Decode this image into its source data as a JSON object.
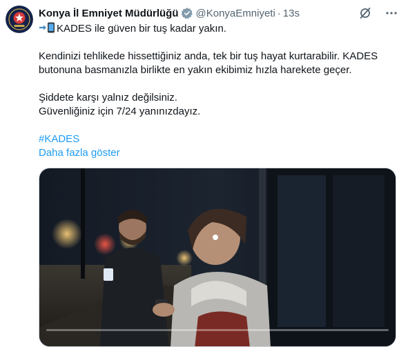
{
  "author": {
    "name": "Konya İl Emniyet Müdürlüğü",
    "handle": "@KonyaEmniyeti",
    "separator": "·",
    "time": "13s"
  },
  "icons": {
    "avatar": "police-badge-icon",
    "verified": "verified-badge-icon",
    "grok": "grok-icon",
    "more": "more-icon",
    "phone": "mobile-phone-arrow-emoji"
  },
  "tweet": {
    "line1": "KADES ile güven bir tuş kadar yakın.",
    "line2": "Kendinizi tehlikede hissettiğiniz anda, tek bir tuş hayat kurtarabilir. KADES",
    "line3": "butonuna basmanızla birlikte en yakın ekibimiz hızla harekete geçer.",
    "line4": "Şiddete karşı yalnız değilsiniz.",
    "line5": "Güvenliğiniz için 7/24 yanınızdayız.",
    "hashtag": "#KADES",
    "show_more": "Daha fazla göster"
  },
  "video": {
    "progress": 0.0
  },
  "colors": {
    "accent": "#1d9bf0",
    "verified": "#829aab",
    "text": "#0f1419",
    "muted": "#536471"
  }
}
